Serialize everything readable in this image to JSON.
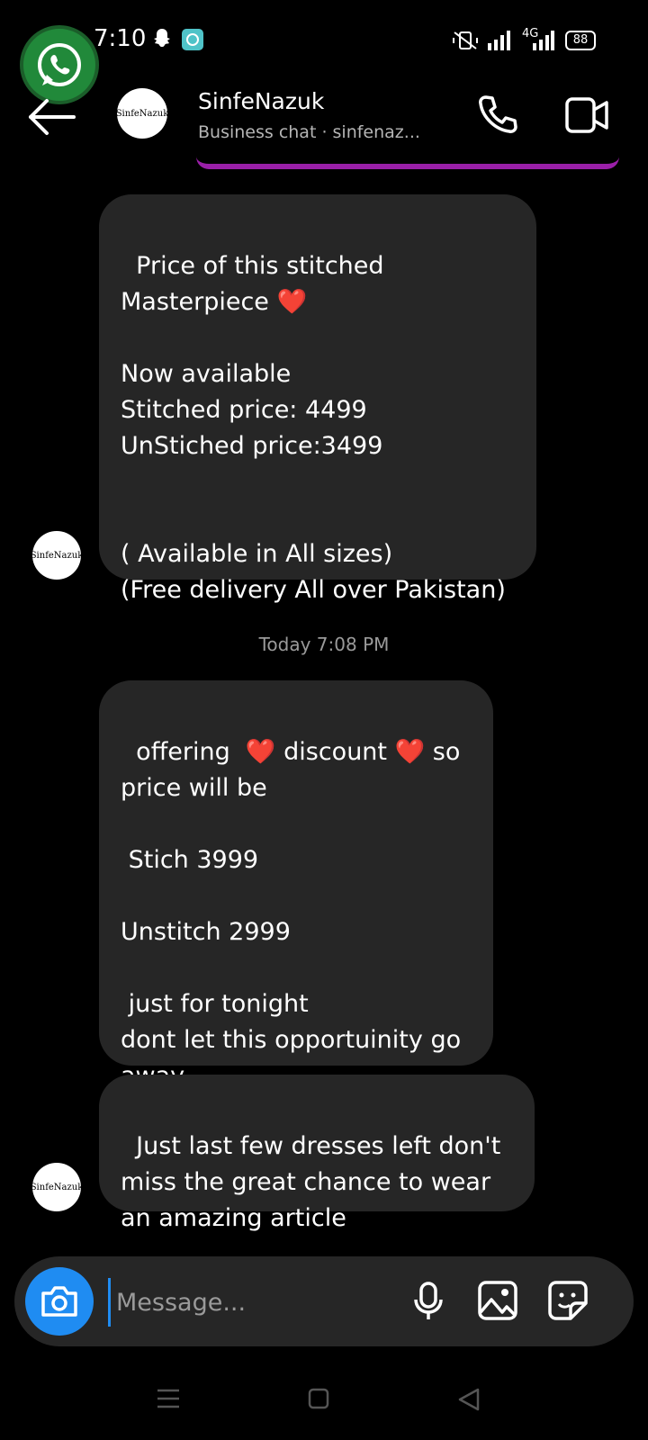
{
  "status_bar": {
    "time": "7:10",
    "network": "4G",
    "battery": "88"
  },
  "header": {
    "avatar_text": "SinfeNazuk",
    "name": "SinfeNazuk",
    "subtitle": "Business chat · sinfenaz..."
  },
  "messages": [
    {
      "text": "Price of this stitched\nMasterpiece ❤️\n\nNow available\nStitched price: 4499\nUnStiched price:3499\n\n\n( Available in All sizes)\n(Free delivery All over Pakistan)"
    },
    {
      "text": "offering  ❤️ discount ❤️ so\nprice will be\n\n Stich 3999\n\nUnstitch 2999\n\n just for tonight\ndont let this opportuinity go\naway"
    },
    {
      "text": "Just last few dresses left don't\nmiss the great chance to wear\nan amazing article"
    }
  ],
  "day_separator": "Today 7:08 PM",
  "composer": {
    "placeholder": "Message..."
  },
  "icons": {
    "back": "arrow-left-icon",
    "call": "phone-icon",
    "video": "video-camera-icon",
    "camera": "camera-icon",
    "mic": "microphone-icon",
    "gallery": "image-icon",
    "sticker": "sticker-icon"
  },
  "colors": {
    "background": "#000000",
    "bubble": "#262626",
    "accent_blue": "#1f8cf2",
    "accent_purple": "#9a1fa8"
  }
}
